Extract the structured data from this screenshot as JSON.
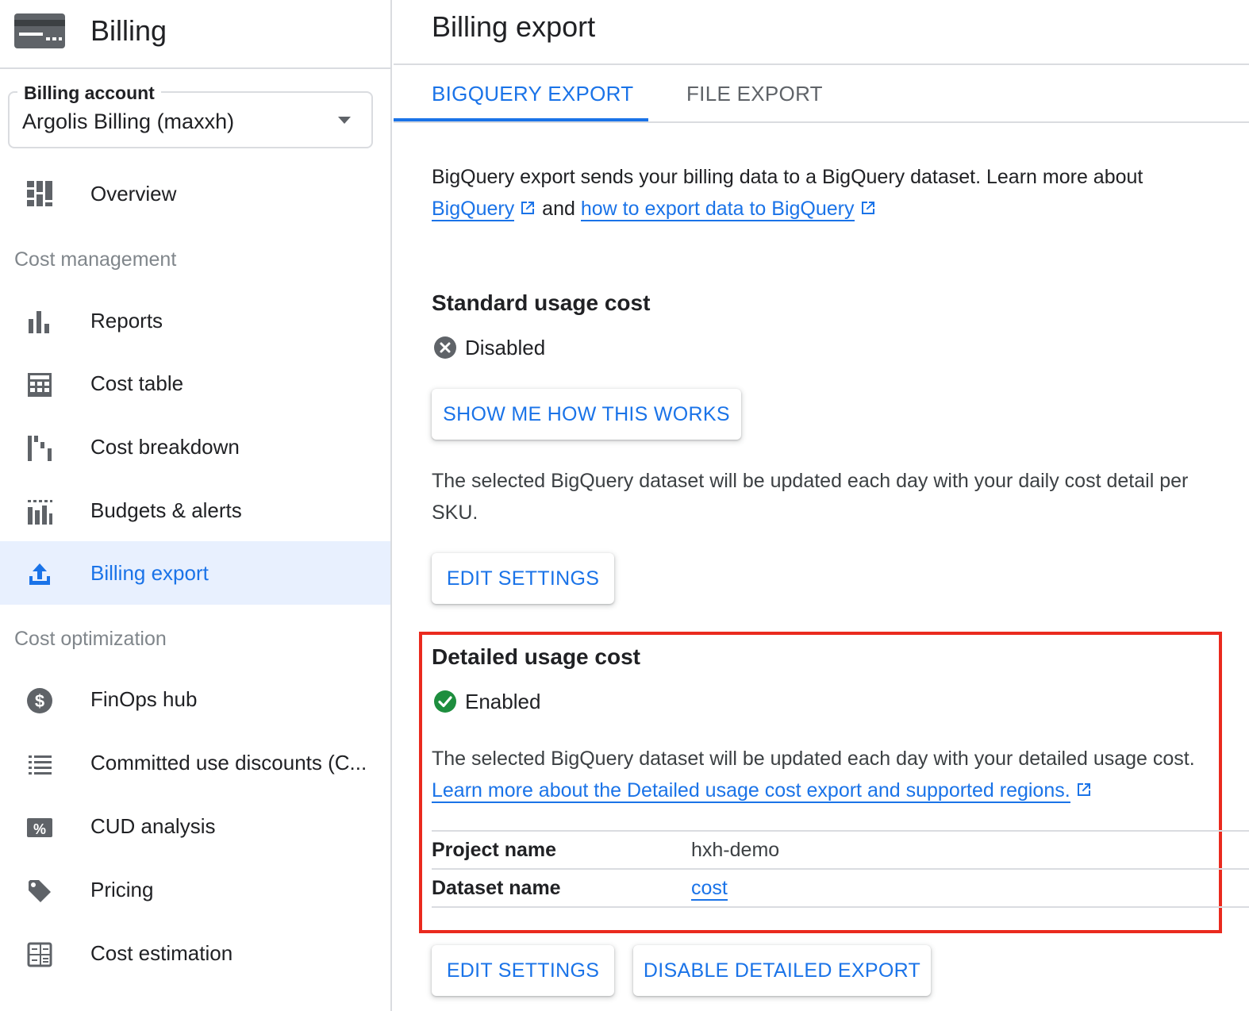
{
  "app": {
    "title": "Billing"
  },
  "billing_account": {
    "label": "Billing account",
    "value": "Argolis Billing (maxxh)"
  },
  "sidebar": {
    "overview": "Overview",
    "section_cost_management": "Cost management",
    "reports": "Reports",
    "cost_table": "Cost table",
    "cost_breakdown": "Cost breakdown",
    "budgets_alerts": "Budgets & alerts",
    "billing_export": "Billing export",
    "section_cost_optimization": "Cost optimization",
    "finops_hub": "FinOps hub",
    "committed_use": "Committed use discounts (C...",
    "cud_analysis": "CUD analysis",
    "pricing": "Pricing",
    "cost_estimation": "Cost estimation"
  },
  "main": {
    "title": "Billing export",
    "tabs": {
      "bigquery": "BIGQUERY EXPORT",
      "file": "FILE EXPORT"
    },
    "intro": {
      "text": "BigQuery export sends your billing data to a BigQuery dataset. Learn more about",
      "link1": "BigQuery",
      "and": "and",
      "link2": "how to export data to BigQuery"
    },
    "standard": {
      "heading": "Standard usage cost",
      "status": "Disabled",
      "show_button": "SHOW ME HOW THIS WORKS",
      "description": "The selected BigQuery dataset will be updated each day with your daily cost detail per SKU.",
      "edit_button": "EDIT SETTINGS"
    },
    "detailed": {
      "heading": "Detailed usage cost",
      "status": "Enabled",
      "description": "The selected BigQuery dataset will be updated each day with your detailed usage cost.",
      "learn_link": "Learn more about the Detailed usage cost export and supported regions.",
      "project_label": "Project name",
      "project_value": "hxh-demo",
      "dataset_label": "Dataset name",
      "dataset_value": "cost",
      "edit_button": "EDIT SETTINGS",
      "disable_button": "DISABLE DETAILED EXPORT"
    }
  },
  "colors": {
    "accent": "#1a73e8",
    "active_bg": "#e8f0fe",
    "enabled": "#1e8e3e",
    "disabled": "#5f6368",
    "highlight_border": "#ea2a1e"
  },
  "icons": {
    "logo": "billing-card-icon",
    "overview": "dashboard-icon",
    "reports": "bar-chart-icon",
    "cost_table": "table-icon",
    "cost_breakdown": "waterfall-icon",
    "budgets_alerts": "budget-icon",
    "billing_export": "upload-icon",
    "finops_hub": "dollar-circle-icon",
    "committed_use": "list-icon",
    "cud_analysis": "percent-icon",
    "pricing": "tag-icon",
    "cost_estimation": "calculator-icon",
    "external": "external-link-icon",
    "disabled": "cancel-circle-icon",
    "enabled": "check-circle-icon"
  }
}
